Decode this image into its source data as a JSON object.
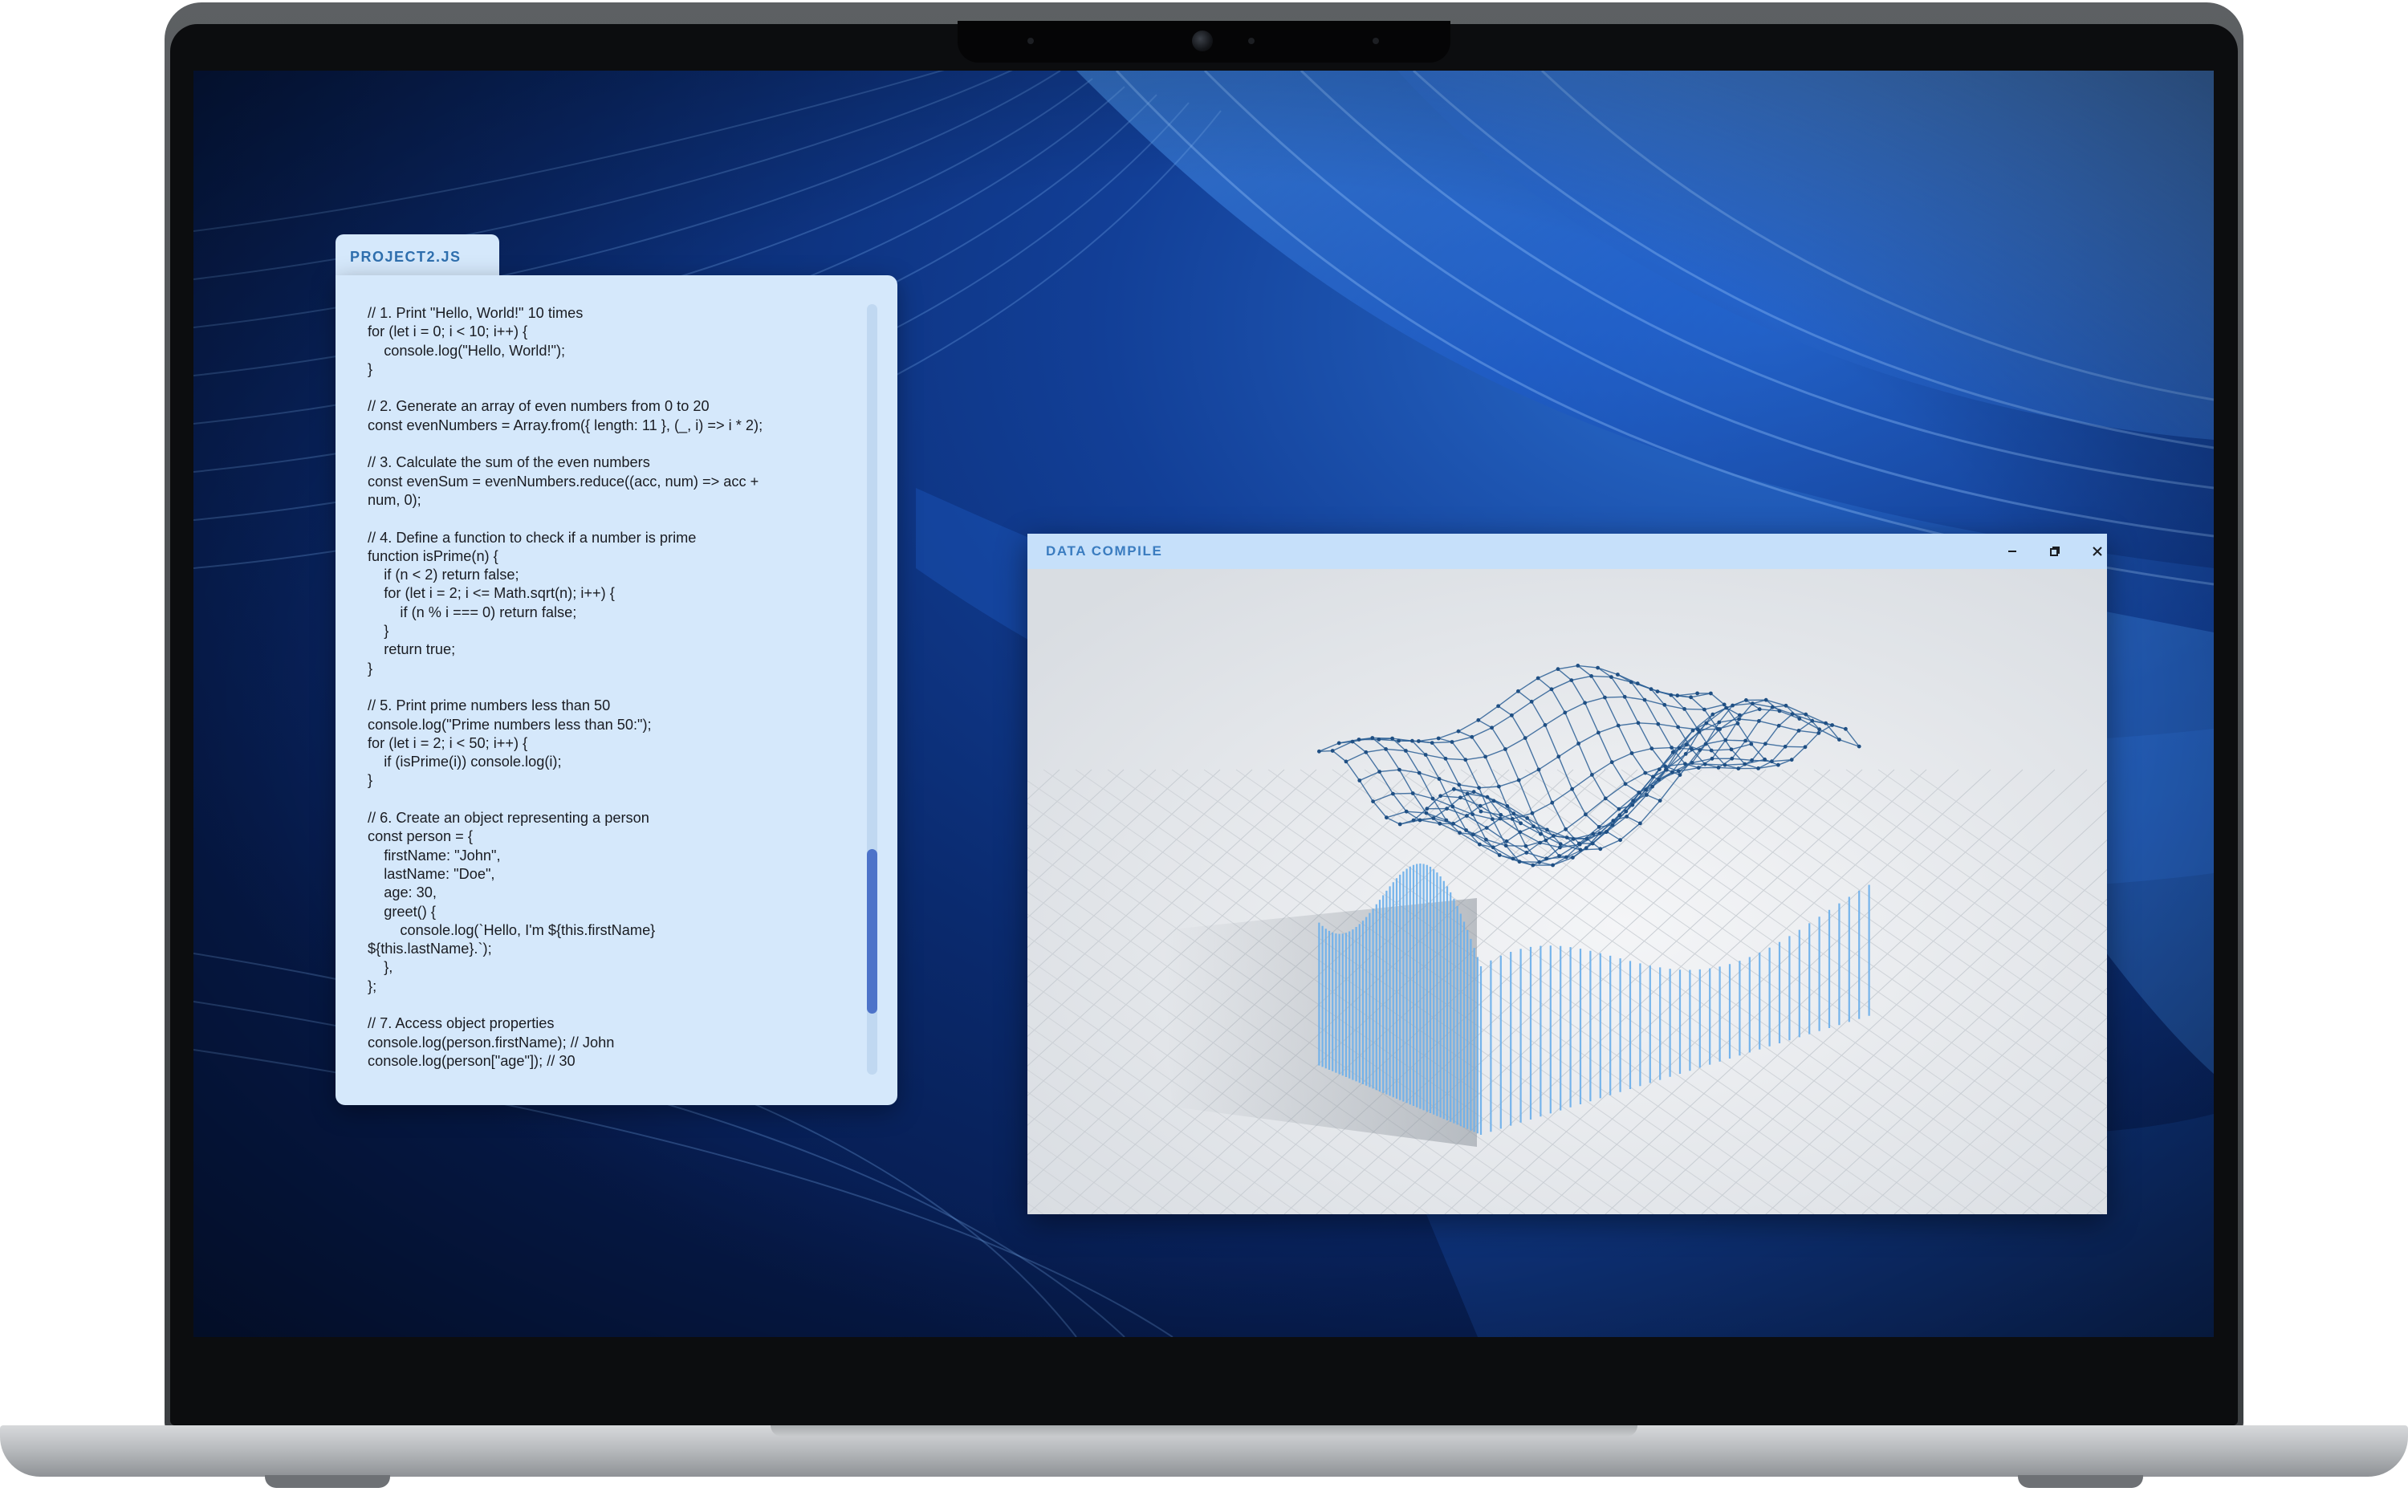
{
  "editor": {
    "tab_label": "PROJECT2.JS",
    "code": "// 1. Print \"Hello, World!\" 10 times\nfor (let i = 0; i < 10; i++) {\n    console.log(\"Hello, World!\");\n}\n\n// 2. Generate an array of even numbers from 0 to 20\nconst evenNumbers = Array.from({ length: 11 }, (_, i) => i * 2);\n\n// 3. Calculate the sum of the even numbers\nconst evenSum = evenNumbers.reduce((acc, num) => acc +\nnum, 0);\n\n// 4. Define a function to check if a number is prime\nfunction isPrime(n) {\n    if (n < 2) return false;\n    for (let i = 2; i <= Math.sqrt(n); i++) {\n        if (n % i === 0) return false;\n    }\n    return true;\n}\n\n// 5. Print prime numbers less than 50\nconsole.log(\"Prime numbers less than 50:\");\nfor (let i = 2; i < 50; i++) {\n    if (isPrime(i)) console.log(i);\n}\n\n// 6. Create an object representing a person\nconst person = {\n    firstName: \"John\",\n    lastName: \"Doe\",\n    age: 30,\n    greet() {\n        console.log(`Hello, I'm ${this.firstName}\n${this.lastName}.`);\n    },\n};\n\n// 7. Access object properties\nconsole.log(person.firstName); // John\nconsole.log(person[\"age\"]); // 30"
  },
  "data_window": {
    "title": "DATA COMPILE",
    "controls": [
      "minimize-icon",
      "restore-icon",
      "close-icon"
    ]
  },
  "colors": {
    "panel": "#d5e8fb",
    "accent_text": "#2f6fae",
    "scroll_thumb": "#4d73c9",
    "bar_blue": "#5aa3e0",
    "mesh": "#2b5f95"
  }
}
